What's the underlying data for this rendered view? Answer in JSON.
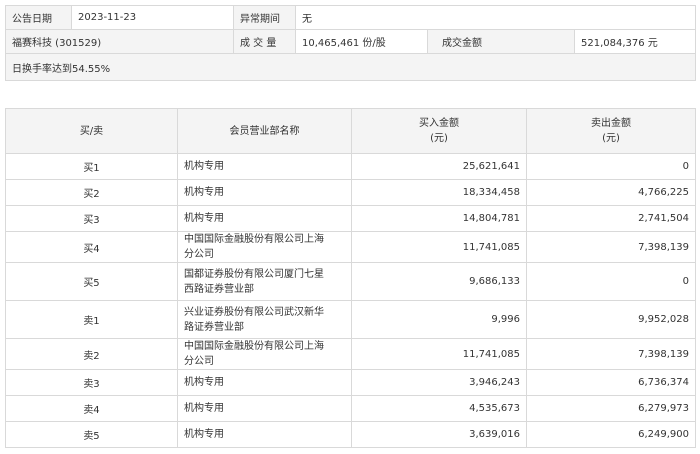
{
  "info": {
    "date_label": "公告日期",
    "date_value": "2023-11-23",
    "period_label": "异常期间",
    "period_value": "无",
    "stock_name": "福赛科技 (301529)",
    "volume_label": "成 交 量",
    "volume_value": "10,465,461 份/股",
    "amount_label": "成交金额",
    "amount_value": "521,084,376 元",
    "turnover_text": "日换手率达到54.55%"
  },
  "table": {
    "headers": {
      "direction": "买/卖",
      "branch": "会员营业部名称",
      "buy_amount": "买入金额",
      "buy_unit": "(元)",
      "sell_amount": "卖出金额",
      "sell_unit": "(元)"
    },
    "rows": [
      {
        "direction": "买1",
        "branch": "机构专用",
        "buy": "25,621,641",
        "sell": "0"
      },
      {
        "direction": "买2",
        "branch": "机构专用",
        "buy": "18,334,458",
        "sell": "4,766,225"
      },
      {
        "direction": "买3",
        "branch": "机构专用",
        "buy": "14,804,781",
        "sell": "2,741,504"
      },
      {
        "direction": "买4",
        "branch": "中国国际金融股份有限公司上海分公司",
        "buy": "11,741,085",
        "sell": "7,398,139"
      },
      {
        "direction": "买5",
        "branch": "国都证券股份有限公司厦门七星西路证券营业部",
        "buy": "9,686,133",
        "sell": "0"
      },
      {
        "direction": "卖1",
        "branch": "兴业证券股份有限公司武汉新华路证券营业部",
        "buy": "9,996",
        "sell": "9,952,028"
      },
      {
        "direction": "卖2",
        "branch": "中国国际金融股份有限公司上海分公司",
        "buy": "11,741,085",
        "sell": "7,398,139"
      },
      {
        "direction": "卖3",
        "branch": "机构专用",
        "buy": "3,946,243",
        "sell": "6,736,374"
      },
      {
        "direction": "卖4",
        "branch": "机构专用",
        "buy": "4,535,673",
        "sell": "6,279,973"
      },
      {
        "direction": "卖5",
        "branch": "机构专用",
        "buy": "3,639,016",
        "sell": "6,249,900"
      }
    ]
  }
}
